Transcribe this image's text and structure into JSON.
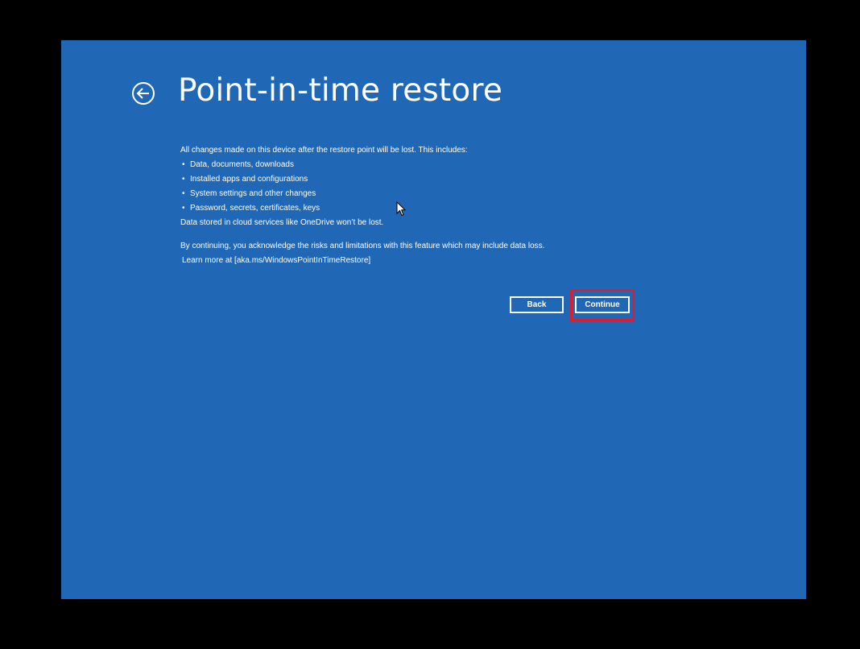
{
  "page": {
    "title": "Point-in-time restore",
    "icons": {
      "back": "back-arrow-circle-icon",
      "cursor": "mouse-pointer-icon"
    },
    "intro": "All changes made on this device after the restore point will be lost. This includes:",
    "bullets": [
      "Data, documents, downloads",
      "Installed apps and configurations",
      "System settings and other changes",
      "Password, secrets, certificates, keys"
    ],
    "cloud_note": "Data stored in cloud services like OneDrive won’t be lost.",
    "acknowledge": "By continuing, you acknowledge the risks and limitations with this feature which may include data loss.",
    "learn_more": "Learn more at [aka.ms/WindowsPointInTimeRestore]"
  },
  "buttons": {
    "back_label": "Back",
    "continue_label": "Continue"
  },
  "colors": {
    "background": "#2067b6",
    "frame": "#000000",
    "text": "#ffffff",
    "highlight": "#d81e2f"
  }
}
